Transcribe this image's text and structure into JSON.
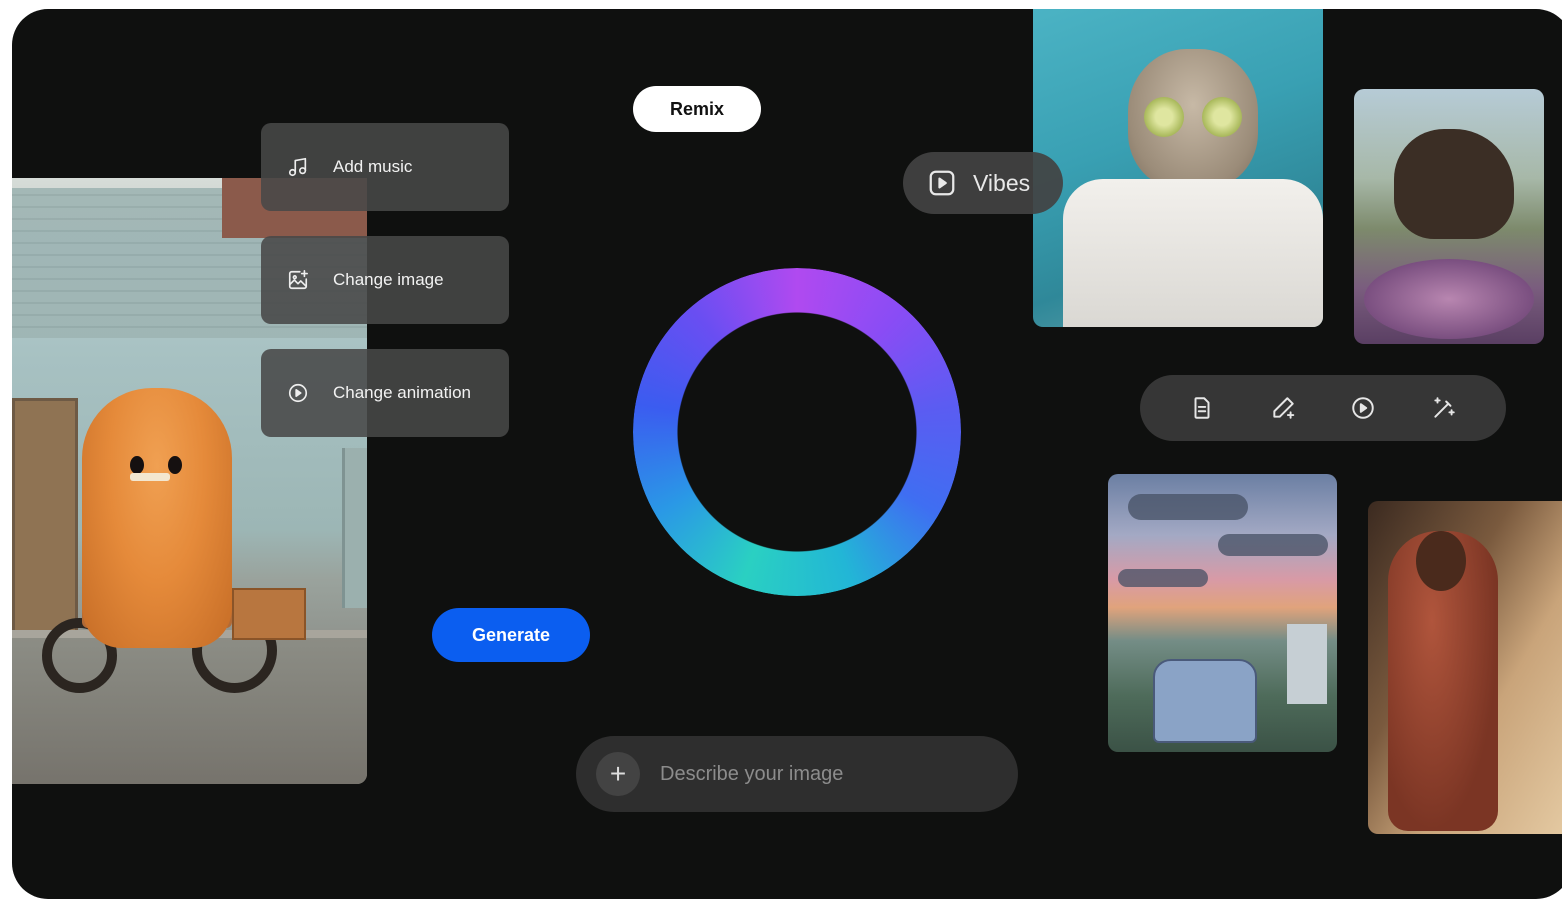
{
  "remix": {
    "label": "Remix"
  },
  "menu": {
    "items": [
      {
        "label": "Add music",
        "icon": "music-note-icon"
      },
      {
        "label": "Change image",
        "icon": "image-sparkle-icon"
      },
      {
        "label": "Change animation",
        "icon": "play-circle-icon"
      }
    ]
  },
  "vibes": {
    "label": "Vibes",
    "icon": "play-square-icon"
  },
  "generate": {
    "label": "Generate"
  },
  "prompt": {
    "placeholder": "Describe your image",
    "add_icon": "plus-icon"
  },
  "toolbar": {
    "icons": [
      "document-icon",
      "pencil-sparkle-icon",
      "play-circle-icon",
      "magic-wand-icon"
    ]
  },
  "colors": {
    "background": "#0f100f",
    "accent": "#0b5ef0",
    "ring_gradient": [
      "#b04af0",
      "#5b5cf2",
      "#2ad0c2"
    ]
  }
}
